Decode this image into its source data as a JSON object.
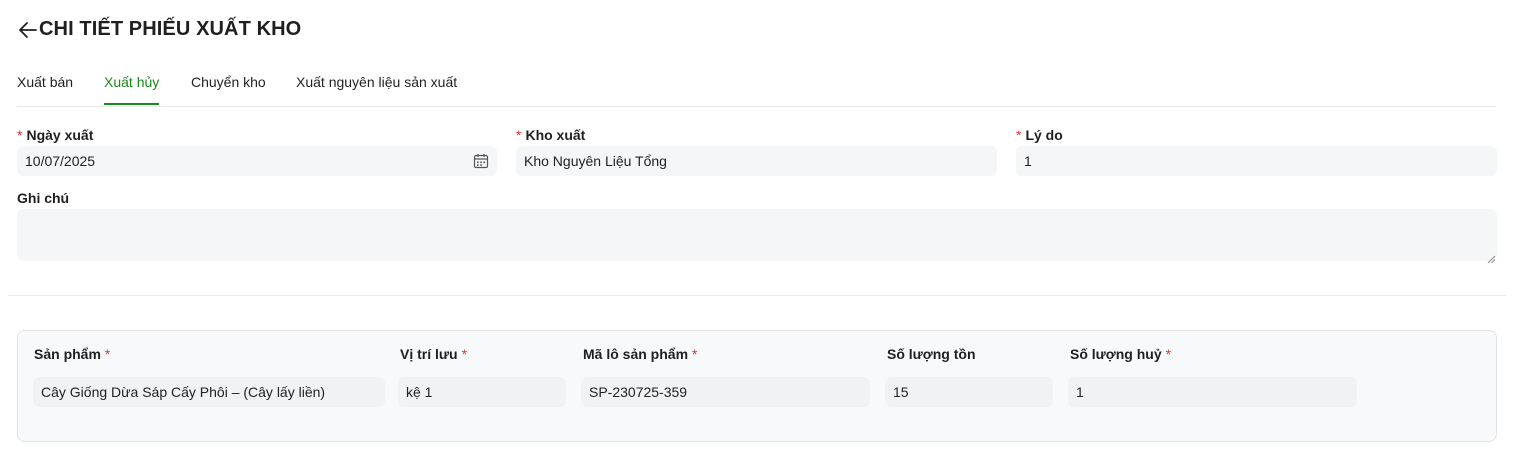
{
  "header": {
    "title": "CHI TIẾT PHIẾU XUẤT KHO"
  },
  "tabs": [
    {
      "label": "Xuất bán"
    },
    {
      "label": "Xuất hủy"
    },
    {
      "label": "Chuyển kho"
    },
    {
      "label": "Xuất nguyên liệu sản xuất"
    }
  ],
  "active_tab": "Xuất hủy",
  "form": {
    "export_date": {
      "label": "Ngày xuất",
      "required_mark": "*",
      "value": "10/07/2025"
    },
    "warehouse": {
      "label": "Kho xuất",
      "required_mark": "*",
      "value": "Kho Nguyên Liệu Tổng"
    },
    "reason": {
      "label": "Lý do",
      "required_mark": "*",
      "value": "1"
    },
    "note": {
      "label": "Ghi chú",
      "value": ""
    }
  },
  "items": {
    "columns": {
      "product": {
        "label": "Sản phẩm",
        "required_mark": "*"
      },
      "location": {
        "label": "Vị trí lưu",
        "required_mark": "*"
      },
      "lot": {
        "label": "Mã lô sản phẩm",
        "required_mark": "*"
      },
      "stock": {
        "label": "Số lượng tồn"
      },
      "qty": {
        "label": "Số lượng huỷ",
        "required_mark": "*"
      }
    },
    "rows": [
      {
        "product": "Cây Giống Dừa Sáp Cấy Phôi – (Cây lấy liền)",
        "location": "kệ 1",
        "lot": "SP-230725-359",
        "stock": "15",
        "qty": "1"
      }
    ]
  },
  "colors": {
    "accent": "#1a8a1a",
    "required": "#e03131",
    "field_bg": "#f5f6f8"
  },
  "icons": {
    "back": "arrow-left-icon",
    "calendar": "calendar-icon"
  }
}
